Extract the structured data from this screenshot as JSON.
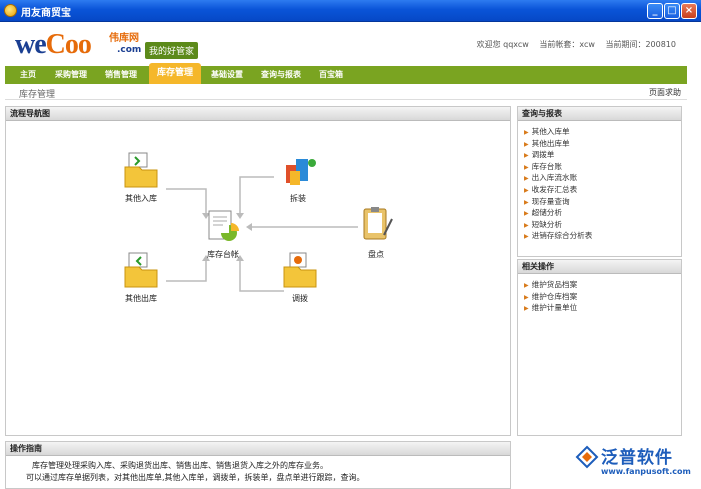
{
  "window": {
    "title": "用友商贸宝",
    "minimize": "_",
    "maximize": "□",
    "close": "×"
  },
  "header": {
    "logo_we": "we",
    "logo_coo": "Coo",
    "logo_cn": "伟库网",
    "logo_dotcom": ".com",
    "slogan": "我的好管家",
    "welcome": "欢迎您 qqxcw",
    "account": "当前帐套：xcw",
    "period": "当前期间：200810"
  },
  "nav": {
    "items": [
      {
        "label": "主页"
      },
      {
        "label": "采购管理"
      },
      {
        "label": "销售管理"
      },
      {
        "label": "库存管理",
        "active": true
      },
      {
        "label": "基础设置"
      },
      {
        "label": "查询与报表"
      },
      {
        "label": "百宝箱"
      }
    ]
  },
  "crumb": {
    "title": "库存管理",
    "help": "页面求助"
  },
  "flow": {
    "title": "流程导航图",
    "nodes": {
      "other_in": "其他入库",
      "split": "拆装",
      "ledger": "库存台帐",
      "count": "盘点",
      "other_out": "其他出库",
      "transfer": "调拨"
    }
  },
  "guide": {
    "title": "操作指南",
    "line1": "库存管理处理采购入库、采购退货出库、销售出库、销售退货入库之外的库存业务。",
    "line2": "可以通过库存单据列表，对其他出库单,其他入库单，调拨单，拆装单，盘点单进行跟踪，查询。"
  },
  "reports": {
    "title": "查询与报表",
    "items": [
      {
        "label": "其他入库单"
      },
      {
        "label": "其他出库单"
      },
      {
        "label": "调拨单"
      },
      {
        "label": "库存台账"
      },
      {
        "label": "出入库流水账"
      },
      {
        "label": "收发存汇总表"
      },
      {
        "label": "现存量查询"
      },
      {
        "label": "超储分析"
      },
      {
        "label": "短缺分析"
      },
      {
        "label": "进销存综合分析表"
      }
    ]
  },
  "related": {
    "title": "相关操作",
    "items": [
      {
        "label": "维护货品档案"
      },
      {
        "label": "维护仓库档案"
      },
      {
        "label": "维护计量单位"
      }
    ]
  },
  "watermark": {
    "brand": "泛普软件",
    "url": "www.fanpusoft.com"
  },
  "colors": {
    "nav": "#7aa421",
    "nav_active": "#f5b72a",
    "titlebar": "#0a54d8",
    "link_arrow": "#d87a1a"
  }
}
